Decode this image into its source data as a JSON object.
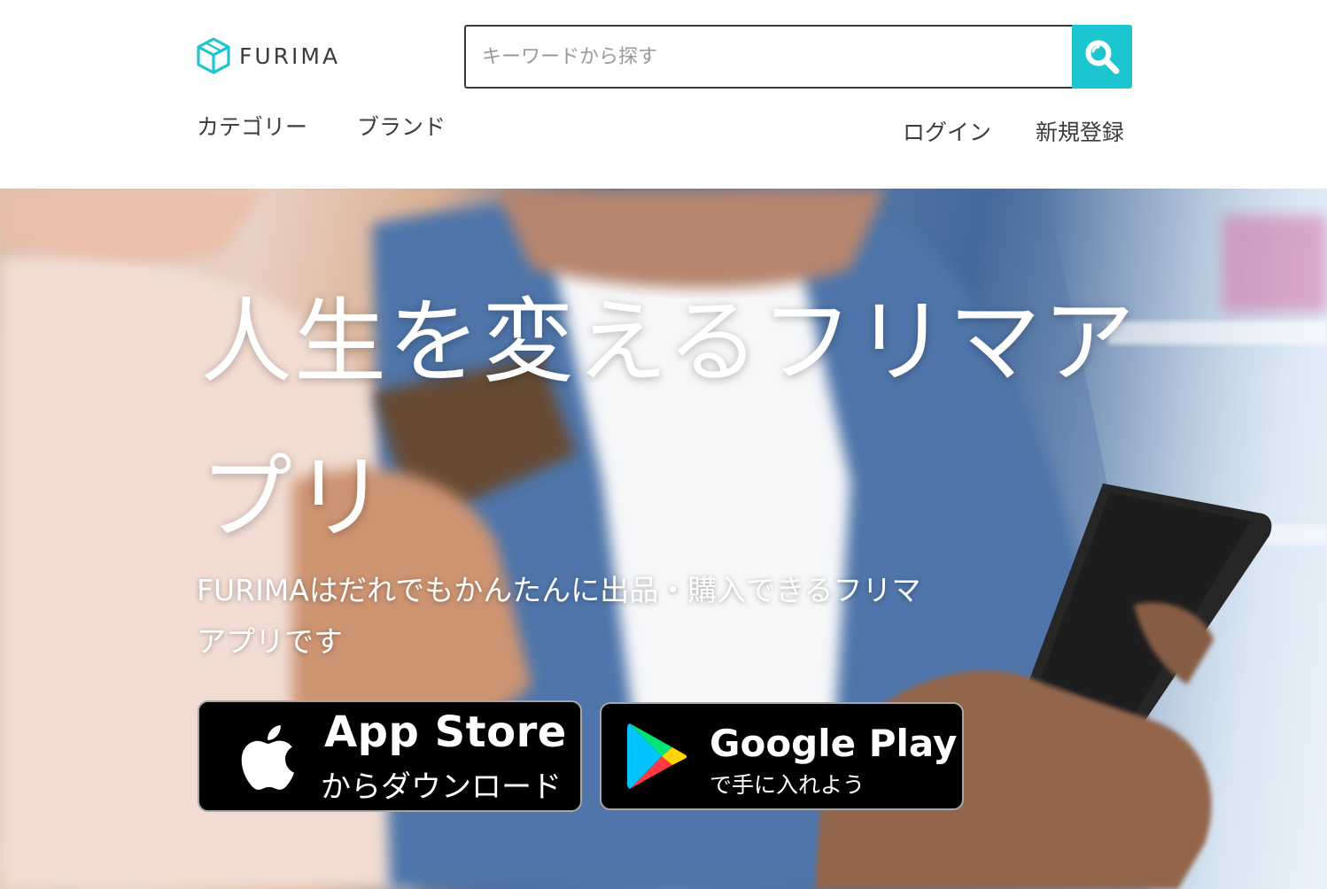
{
  "header": {
    "logo_text": "FURIMA",
    "search": {
      "placeholder": "キーワードから探す",
      "value": ""
    },
    "nav_left": {
      "category": "カテゴリー",
      "brand": "ブランド"
    },
    "nav_right": {
      "login": "ログイン",
      "signup": "新規登録"
    }
  },
  "hero": {
    "title": "人生を変えるフリマアプリ",
    "description": "FURIMAはだれでもかんたんに出品・購入できるフリマアプリです",
    "badges": {
      "app_store": {
        "main": "App Store",
        "sub": "からダウンロード"
      },
      "google_play": {
        "main": "Google Play",
        "sub": "で手に入れよう"
      }
    }
  },
  "icons": {
    "logo": "box-logo-icon",
    "search": "search-icon",
    "apple": "apple-logo-icon",
    "play": "google-play-icon"
  },
  "colors": {
    "accent": "#1cc6ce",
    "text": "#3c3c3c",
    "hero_text": "#ffffff",
    "badge_bg": "#000000"
  }
}
